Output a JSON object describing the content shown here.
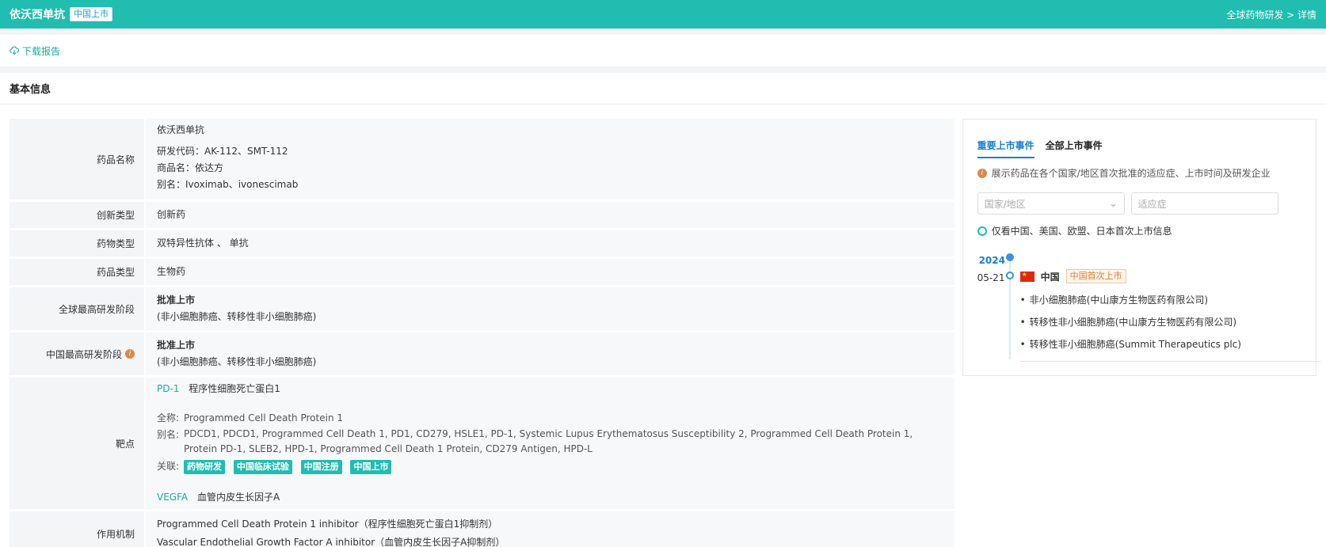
{
  "header": {
    "title": "依沃西单抗",
    "badge": "中国上市",
    "breadcrumb": "全球药物研发 > 详情"
  },
  "toolbar": {
    "download_label": "下载报告"
  },
  "section": {
    "title": "基本信息"
  },
  "info": {
    "drug_name_label": "药品名称",
    "drug_name": "依沃西单抗",
    "dev_code": "研发代码：AK-112、SMT-112",
    "trade_name": "商品名：依达方",
    "alias": "别名：Ivoximab、ivonescimab",
    "innovation_label": "创新类型",
    "innovation": "创新药",
    "drug_type_label": "药物类型",
    "drug_type": "双特异性抗体 、 单抗",
    "product_type_label": "药品类型",
    "product_type": "生物药",
    "global_stage_label": "全球最高研发阶段",
    "global_stage": "批准上市",
    "global_stage_ind": "(非小细胞肺癌、转移性非小细胞肺癌)",
    "china_stage_label": "中国最高研发阶段",
    "china_stage": "批准上市",
    "china_stage_ind": "(非小细胞肺癌、转移性非小细胞肺癌)",
    "target_label": "靶点",
    "target1_code": "PD-1",
    "target1_name": "程序性细胞死亡蛋白1",
    "fullname_key": "全称:",
    "target1_full": "Programmed Cell Death Protein 1",
    "alias_key": "别名:",
    "target1_alias": "PDCD1, PDCD1, Programmed Cell Death 1, PD1, CD279, HSLE1, PD-1, Systemic Lupus Erythematosus Susceptibility 2, Programmed Cell Death Protein 1, Protein PD-1, SLEB2, HPD-1, Programmed Cell Death 1 Protein, CD279 Antigen, HPD-L",
    "related_key": "关联:",
    "related_tags": [
      "药物研发",
      "中国临床试验",
      "中国注册",
      "中国上市"
    ],
    "target2_code": "VEGFA",
    "target2_name": "血管内皮生长因子A",
    "mechanism_label": "作用机制",
    "mechanism1": "Programmed Cell Death Protein 1 inhibitor（程序性细胞死亡蛋白1抑制剂）",
    "mechanism2": "Vascular Endothelial Growth Factor A inhibitor（血管内皮生长因子A抑制剂）"
  },
  "panel": {
    "tab_active": "重要上市事件",
    "tab_other": "全部上市事件",
    "note": "展示药品在各个国家/地区首次批准的适应症、上市时间及研发企业",
    "country_placeholder": "国家/地区",
    "indication_placeholder": "适应症",
    "radio_label": "仅看中国、美国、欧盟、日本首次上市信息",
    "year": "2024",
    "date": "05-21",
    "country": "中国",
    "first_tag": "中国首次上市",
    "events": [
      "非小细胞肺癌(中山康方生物医药有限公司)",
      "转移性非小细胞肺癌(中山康方生物医药有限公司)",
      "转移性非小细胞肺癌(Summit Therapeutics plc)"
    ]
  }
}
